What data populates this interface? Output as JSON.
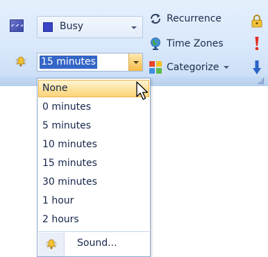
{
  "ribbon": {
    "show_as": {
      "value": "Busy",
      "swatch_color": "#3a44c4",
      "icon": "show-as-icon"
    },
    "reminder": {
      "value": "15 minutes",
      "icon": "bell-icon"
    },
    "buttons": {
      "recurrence": "Recurrence",
      "time_zones": "Time Zones",
      "categorize": "Categorize"
    },
    "side_icons": [
      "lock-icon",
      "high-importance-icon",
      "low-importance-icon"
    ]
  },
  "reminder_menu": {
    "items": [
      {
        "label": "None",
        "selected": true
      },
      {
        "label": "0 minutes",
        "selected": false
      },
      {
        "label": "5 minutes",
        "selected": false
      },
      {
        "label": "10 minutes",
        "selected": false
      },
      {
        "label": "15 minutes",
        "selected": false
      },
      {
        "label": "30 minutes",
        "selected": false
      },
      {
        "label": "1 hour",
        "selected": false
      },
      {
        "label": "2 hours",
        "selected": false
      }
    ],
    "sound_label": "Sound..."
  },
  "colors": {
    "accent_highlight": "#fbd37a",
    "selection_blue": "#3466c7",
    "ribbon_bg": "#d9e8fb"
  }
}
